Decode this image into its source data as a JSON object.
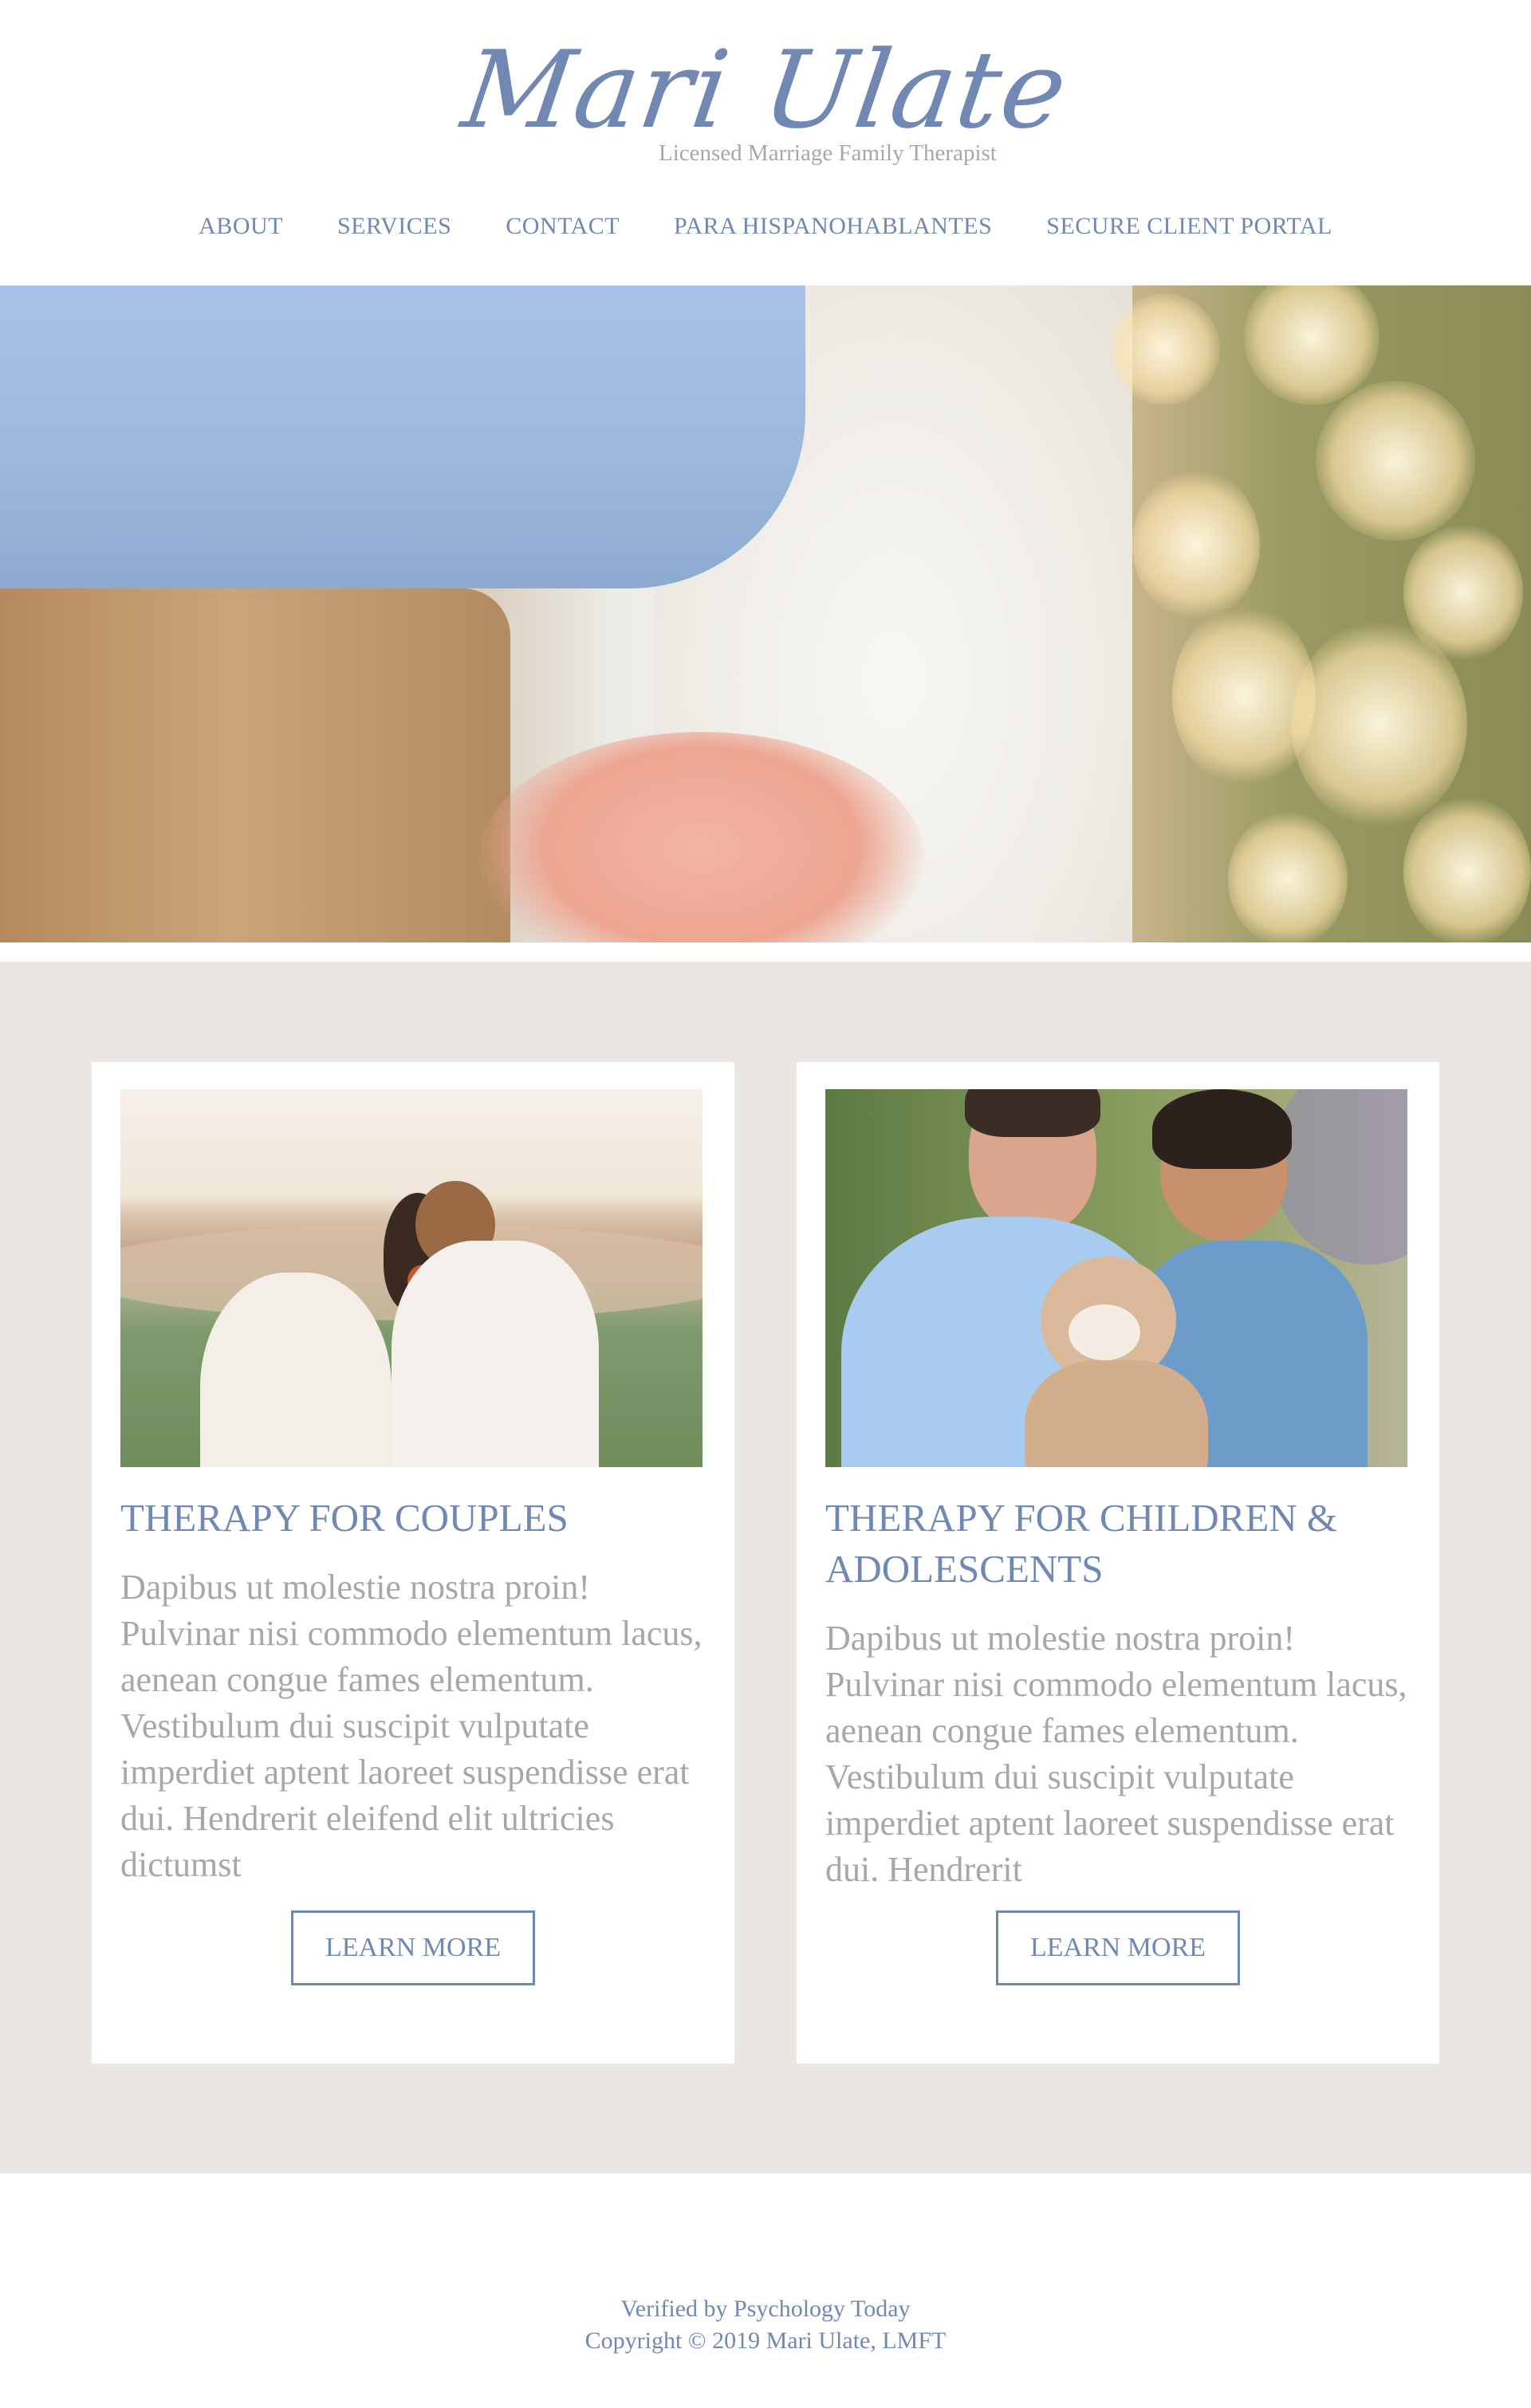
{
  "header": {
    "brand": "Mari Ulate",
    "tagline": "Licensed Marriage Family Therapist"
  },
  "nav": {
    "items": [
      "ABOUT",
      "SERVICES",
      "CONTACT",
      "PARA HISPANOHABLANTES",
      "SECURE CLIENT PORTAL"
    ]
  },
  "services": {
    "cards": [
      {
        "title": "THERAPY FOR COUPLES",
        "body": "Dapibus ut molestie nostra proin! Pulvinar nisi commodo elementum lacus, aenean congue fames elementum. Vestibulum dui suscipit vulputate imperdiet aptent laoreet suspendisse erat dui. Hendrerit eleifend elit ultricies dictumst",
        "button": "LEARN MORE"
      },
      {
        "title": "THERAPY FOR CHILDREN & ADOLESCENTS",
        "body": "Dapibus ut molestie nostra proin! Pulvinar nisi commodo elementum lacus, aenean congue fames elementum. Vestibulum dui suscipit vulputate imperdiet aptent laoreet suspendisse erat dui. Hendrerit",
        "button": "LEARN MORE"
      }
    ]
  },
  "footer": {
    "verified": "Verified by Psychology Today",
    "copyright": "Copyright © 2019 Mari Ulate, LMFT"
  },
  "colors": {
    "accent": "#7188b2",
    "muted_text": "#a7a7a7",
    "section_bg": "#ece6e2"
  }
}
